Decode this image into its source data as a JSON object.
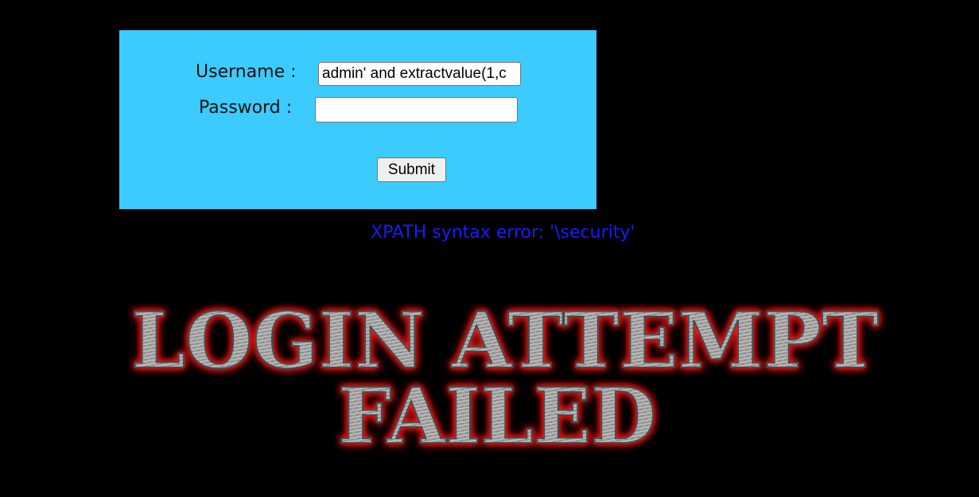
{
  "form": {
    "username_label": "Username :",
    "password_label": "Password :",
    "username_value": "admin' and extractvalue(1,c",
    "password_value": "",
    "submit_label": "Submit"
  },
  "error": {
    "message": "XPATH syntax error: '\\security'"
  },
  "banner": {
    "line1": "LOGIN ATTEMPT",
    "line2": "FAILED"
  },
  "colors": {
    "background": "#000000",
    "form_background": "#3ccbff",
    "error_text": "#1a1aff",
    "banner_glow": "#ff1a1a",
    "banner_metal": "#a9a9a9"
  }
}
